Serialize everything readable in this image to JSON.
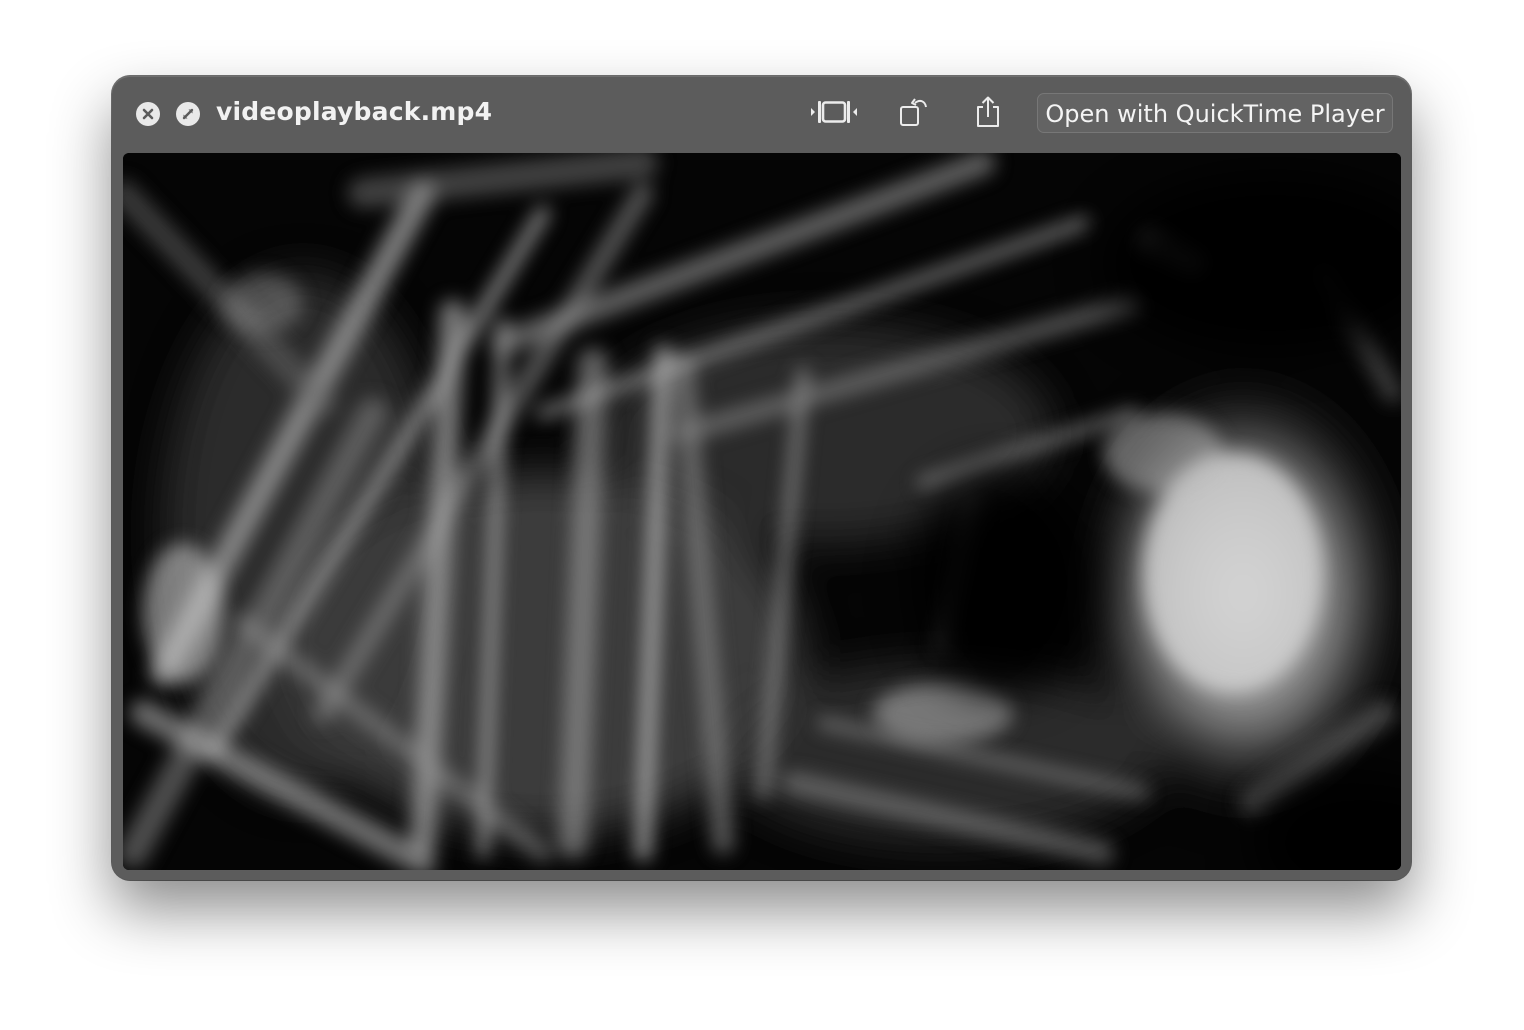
{
  "window": {
    "title": "videoplayback.mp4",
    "accent_color": "#5c5c5c"
  },
  "controls": {
    "close_icon": "close-icon",
    "fullscreen_icon": "fullscreen-icon",
    "trim_icon": "trim-icon",
    "rotate_icon": "rotate-icon",
    "share_icon": "share-icon",
    "open_button_label": "Open with QuickTime Player"
  },
  "preview": {
    "content": "video-frame",
    "color_mode": "grayscale"
  }
}
